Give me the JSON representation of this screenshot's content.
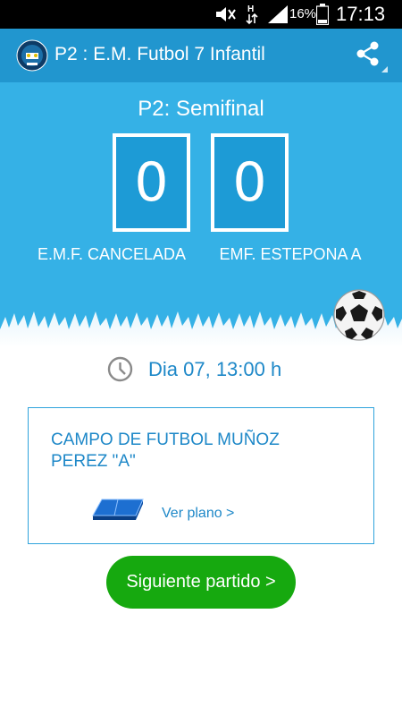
{
  "status_bar": {
    "battery_percent": "16%",
    "time": "17:13",
    "icons": [
      "mute-icon",
      "data-transfer-icon",
      "signal-icon",
      "battery-icon"
    ]
  },
  "app_bar": {
    "title": "P2 : E.M. Futbol 7 Infantil",
    "logo_icon": "league-logo",
    "action_icon": "share-icon"
  },
  "match": {
    "round": "P2: Semifinal",
    "home_score": "0",
    "away_score": "0",
    "home_team": "E.M.F. CANCELADA",
    "away_team": "EMF. ESTEPONA A",
    "date_time": "Dia 07, 13:00 h"
  },
  "venue": {
    "name": "CAMPO DE FUTBOL MUÑOZ PEREZ \"A\"",
    "map_link": "Ver plano >"
  },
  "actions": {
    "next_match": "Siguiente partido >"
  },
  "colors": {
    "app_bar": "#2196cf",
    "hero": "#35b1e6",
    "score_box": "#1d9bd6",
    "accent_text": "#1e88c8",
    "next_button": "#16a90f"
  }
}
